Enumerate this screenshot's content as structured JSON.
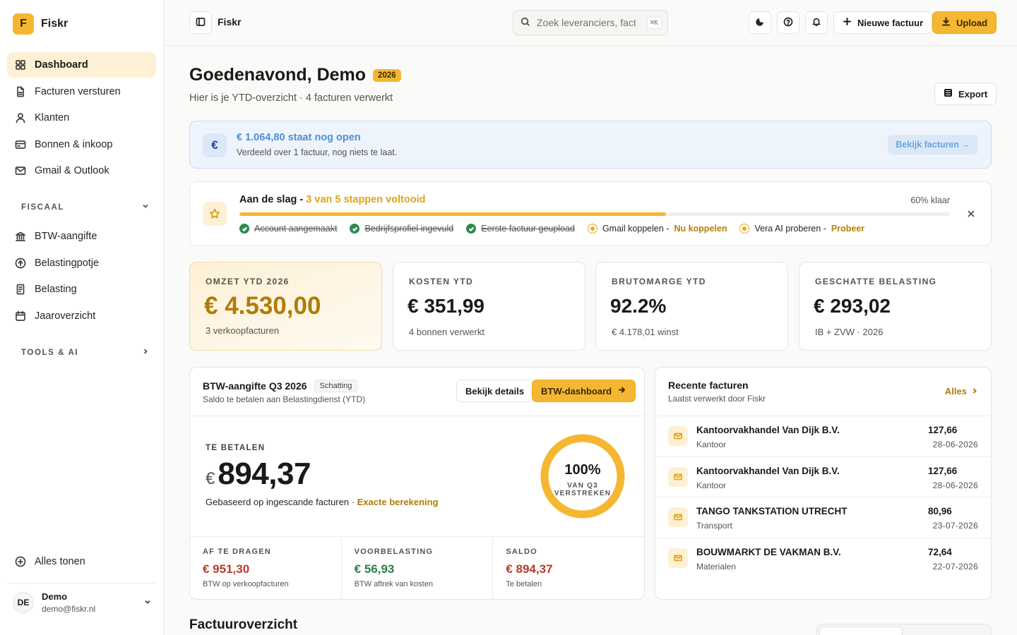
{
  "brand": {
    "logo_letter": "F",
    "name": "Fiskr"
  },
  "sidebar": {
    "main_items": [
      {
        "label": "Dashboard",
        "icon": "grid-icon",
        "active": true
      },
      {
        "label": "Facturen versturen",
        "icon": "document-icon"
      },
      {
        "label": "Klanten",
        "icon": "user-icon"
      },
      {
        "label": "Bonnen & inkoop",
        "icon": "wallet-icon"
      },
      {
        "label": "Gmail & Outlook",
        "icon": "mail-icon"
      }
    ],
    "fiscaal_label": "FISCAAL",
    "fiscaal_items": [
      {
        "label": "BTW-aangifte",
        "icon": "bank-icon"
      },
      {
        "label": "Belastingpotje",
        "icon": "coin-icon"
      },
      {
        "label": "Belasting",
        "icon": "receipt-icon"
      },
      {
        "label": "Jaaroverzicht",
        "icon": "calendar-icon"
      }
    ],
    "tools_label": "TOOLS & AI",
    "show_all": "Alles tonen",
    "user": {
      "initials": "DE",
      "name": "Demo",
      "email": "demo@fiskr.nl"
    }
  },
  "topbar": {
    "title": "Fiskr",
    "search_placeholder": "Zoek leveranciers, factu",
    "search_shortcut": "⌘K",
    "new_invoice": "Nieuwe factuur",
    "upload": "Upload"
  },
  "header": {
    "greeting": "Goedenavond, Demo",
    "year": "2026",
    "subtitle": "Hier is je YTD-overzicht · 4 facturen verwerkt",
    "export": "Export"
  },
  "open_banner": {
    "symbol": "€",
    "title": "€ 1.064,80 staat nog open",
    "subtitle": "Verdeeld over 1 factuur, nog niets te laat.",
    "button": "Bekijk facturen →"
  },
  "onboarding": {
    "title": "Aan de slag",
    "separator": " - ",
    "steps_text": "3 van 5 stappen voltooid",
    "percent_label": "60% klaar",
    "progress": 0.6,
    "steps": [
      {
        "label": "Account aangemaakt",
        "done": true
      },
      {
        "label": "Bedrijfsprofiel ingevuld",
        "done": true
      },
      {
        "label": "Eerste factuur geupload",
        "done": true
      },
      {
        "label": "Gmail koppelen -",
        "done": false,
        "cta": "Nu koppelen"
      },
      {
        "label": "Vera AI proberen -",
        "done": false,
        "cta": "Probeer"
      }
    ]
  },
  "stats": [
    {
      "label": "OMZET YTD 2026",
      "value": "€ 4.530,00",
      "sub": "3 verkoopfacturen"
    },
    {
      "label": "KOSTEN YTD",
      "value": "€ 351,99",
      "sub": "4 bonnen verwerkt"
    },
    {
      "label": "BRUTOMARGE YTD",
      "value": "92.2%",
      "sub": "€ 4.178,01 winst"
    },
    {
      "label": "GESCHATTE BELASTING",
      "value": "€ 293,02",
      "sub": "IB + ZVW · 2026"
    }
  ],
  "btw": {
    "title": "BTW-aangifte Q3 2026",
    "tag": "Schatting",
    "subtitle": "Saldo te betalen aan Belastingdienst (YTD)",
    "details_btn": "Bekijk details",
    "dashboard_btn": "BTW-dashboard",
    "pay_label": "TE BETALEN",
    "currency": "€",
    "pay_value": "894,37",
    "note": "Gebaseerd op ingescande facturen ·",
    "note_link": "Exacte berekening",
    "donut_pct": "100%",
    "donut_fraction": 1.0,
    "donut_label": "VAN Q3 VERSTREKEN",
    "columns": [
      {
        "label": "AF TE DRAGEN",
        "value": "€ 951,30",
        "sub": "BTW op verkoopfacturen",
        "tone": "red"
      },
      {
        "label": "VOORBELASTING",
        "value": "€ 56,93",
        "sub": "BTW aftrek van kosten",
        "tone": "green"
      },
      {
        "label": "SALDO",
        "value": "€ 894,37",
        "sub": "Te betalen",
        "tone": "red"
      }
    ]
  },
  "recent": {
    "title": "Recente facturen",
    "subtitle": "Laatst verwerkt door Fiskr",
    "all": "Alles",
    "rows": [
      {
        "name": "Kantoorvakhandel Van Dijk B.V.",
        "category": "Kantoor",
        "amount": "127,66",
        "date": "28-06-2026"
      },
      {
        "name": "Kantoorvakhandel Van Dijk B.V.",
        "category": "Kantoor",
        "amount": "127,66",
        "date": "28-06-2026"
      },
      {
        "name": "TANGO TANKSTATION UTRECHT",
        "category": "Transport",
        "amount": "80,96",
        "date": "23-07-2026"
      },
      {
        "name": "BOUWMARKT DE VAKMAN B.V.",
        "category": "Materialen",
        "amount": "72,64",
        "date": "22-07-2026"
      }
    ]
  },
  "overview": {
    "title": "Factuuroverzicht"
  },
  "colors": {
    "accent": "#f5b731",
    "accent_text": "#b07c08",
    "info": "#4a90d9",
    "success": "#2f8a4e",
    "danger": "#b83a2a"
  }
}
